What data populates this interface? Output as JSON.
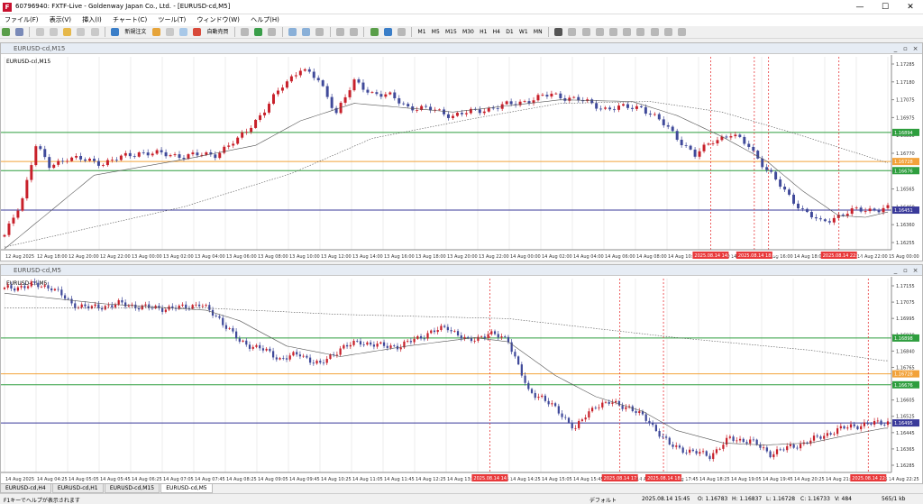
{
  "app": {
    "title": "60796940: FXTF-Live - Goldenway Japan Co., Ltd. - [EURUSD-cd,M5]",
    "icon_letter": "F"
  },
  "window_controls": [
    "—",
    "☐",
    "✕"
  ],
  "menu": [
    "ファイル(F)",
    "表示(V)",
    "挿入(I)",
    "チャート(C)",
    "ツール(T)",
    "ウィンドウ(W)",
    "ヘルプ(H)"
  ],
  "toolbar": {
    "new_order": "新規注文",
    "auto_trade": "自動売買",
    "timeframes": [
      "M1",
      "M5",
      "M15",
      "M30",
      "H1",
      "H4",
      "D1",
      "W1",
      "MN"
    ]
  },
  "colors": {
    "bull": "#c8202a",
    "bear": "#404a9a",
    "grid": "#ececec",
    "hline_green": "#2e9e3e",
    "hline_orange": "#f2a23a",
    "hline_blue": "#3a3a9a",
    "vline_red": "#e8383a",
    "ma_solid": "#555555",
    "ma_dotted": "#555555"
  },
  "chart_top": {
    "title": "EURUSD-cd,M15",
    "symbol_label": "EURUSD-cd,M15",
    "ylim": [
      16225,
      17325
    ],
    "price_ticks": [
      "1.17285",
      "1.17180",
      "1.17075",
      "1.16975",
      "1.16880",
      "1.16770",
      "1.16665",
      "1.16565",
      "1.16460",
      "1.16360",
      "1.16255"
    ],
    "hlines": [
      {
        "price": 16894,
        "label": "1.16894",
        "color": "green"
      },
      {
        "price": 16728,
        "label": "1.16728",
        "color": "orange"
      },
      {
        "price": 16676,
        "label": "1.16676",
        "color": "green"
      },
      {
        "price": 16451,
        "label": "1.16451",
        "color": "blue"
      }
    ],
    "vlines_x": [
      0.797,
      0.846,
      0.862,
      0.941
    ],
    "time_labels": [
      "12 Aug 2025",
      "12 Aug 18:00",
      "12 Aug 20:00",
      "12 Aug 22:00",
      "13 Aug 00:00",
      "13 Aug 02:00",
      "13 Aug 04:00",
      "13 Aug 06:00",
      "13 Aug 08:00",
      "13 Aug 10:00",
      "13 Aug 12:00",
      "13 Aug 14:00",
      "13 Aug 16:00",
      "13 Aug 18:00",
      "13 Aug 20:00",
      "13 Aug 22:00",
      "14 Aug 00:00",
      "14 Aug 02:00",
      "14 Aug 04:00",
      "14 Aug 06:00",
      "14 Aug 08:00",
      "14 Aug 10:00",
      "14 Aug 12:00",
      "14 Aug 14:00",
      "14 Aug 16:00",
      "14 Aug 18:00",
      "14 Aug 20:00",
      "14 Aug 22:00",
      "15 Aug 00:00"
    ],
    "red_time_labels": [
      {
        "x": 0.797,
        "label": "2025.08.14 14:15"
      },
      {
        "x": 0.846,
        "label": "2025.08.14 18:00"
      },
      {
        "x": 0.941,
        "label": "2025.08.14 22:30"
      }
    ],
    "close_keys": [
      [
        0,
        16300
      ],
      [
        4,
        16520
      ],
      [
        7,
        16820
      ],
      [
        10,
        16700
      ],
      [
        14,
        16750
      ],
      [
        22,
        16720
      ],
      [
        30,
        16780
      ],
      [
        40,
        16760
      ],
      [
        47,
        16770
      ],
      [
        52,
        16850
      ],
      [
        58,
        17020
      ],
      [
        62,
        17160
      ],
      [
        66,
        17260
      ],
      [
        70,
        17190
      ],
      [
        74,
        17010
      ],
      [
        78,
        17180
      ],
      [
        82,
        17120
      ],
      [
        86,
        17100
      ],
      [
        90,
        17040
      ],
      [
        96,
        17020
      ],
      [
        100,
        16990
      ],
      [
        106,
        17020
      ],
      [
        114,
        17060
      ],
      [
        122,
        17110
      ],
      [
        128,
        17080
      ],
      [
        134,
        17030
      ],
      [
        142,
        17040
      ],
      [
        148,
        16920
      ],
      [
        154,
        16760
      ],
      [
        158,
        16850
      ],
      [
        162,
        16880
      ],
      [
        166,
        16820
      ],
      [
        170,
        16680
      ],
      [
        174,
        16560
      ],
      [
        178,
        16450
      ],
      [
        182,
        16380
      ],
      [
        186,
        16420
      ],
      [
        190,
        16450
      ],
      [
        197,
        16460
      ]
    ],
    "ma_keys": [
      [
        0,
        16230
      ],
      [
        20,
        16650
      ],
      [
        40,
        16740
      ],
      [
        56,
        16820
      ],
      [
        66,
        16960
      ],
      [
        78,
        17060
      ],
      [
        100,
        17010
      ],
      [
        124,
        17080
      ],
      [
        140,
        17070
      ],
      [
        150,
        16990
      ],
      [
        160,
        16870
      ],
      [
        170,
        16730
      ],
      [
        178,
        16560
      ],
      [
        186,
        16420
      ],
      [
        192,
        16410
      ],
      [
        197,
        16440
      ]
    ],
    "ma2_keys": [
      [
        0,
        16240
      ],
      [
        40,
        16470
      ],
      [
        64,
        16660
      ],
      [
        82,
        16860
      ],
      [
        104,
        16970
      ],
      [
        124,
        17060
      ],
      [
        144,
        17070
      ],
      [
        160,
        17010
      ],
      [
        176,
        16890
      ],
      [
        197,
        16720
      ]
    ],
    "n_candles": 198
  },
  "chart_bottom": {
    "title": "EURUSD-cd,M5",
    "symbol_label": "EURUSD-cd,M5",
    "ylim": [
      16260,
      17180
    ],
    "price_ticks": [
      "1.17155",
      "1.17075",
      "1.16995",
      "1.16920",
      "1.16840",
      "1.16765",
      "1.16685",
      "1.16605",
      "1.16525",
      "1.16445",
      "1.16365",
      "1.16285"
    ],
    "hlines": [
      {
        "price": 16898,
        "label": "1.16898",
        "color": "green"
      },
      {
        "price": 16728,
        "label": "1.16728",
        "color": "orange"
      },
      {
        "price": 16676,
        "label": "1.16676",
        "color": "green"
      },
      {
        "price": 16495,
        "label": "1.16495",
        "color": "blue"
      }
    ],
    "vlines_x": [
      0.549,
      0.695,
      0.744,
      0.974
    ],
    "time_labels": [
      "14 Aug 2025",
      "14 Aug 04:25",
      "14 Aug 05:05",
      "14 Aug 05:45",
      "14 Aug 06:25",
      "14 Aug 07:05",
      "14 Aug 07:45",
      "14 Aug 08:25",
      "14 Aug 09:05",
      "14 Aug 09:45",
      "14 Aug 10:25",
      "14 Aug 11:05",
      "14 Aug 11:45",
      "14 Aug 12:25",
      "14 Aug 13:05",
      "14 Aug 13:45",
      "14 Aug 14:25",
      "14 Aug 15:05",
      "14 Aug 15:45",
      "14 Aug 16:25",
      "14 Aug 17:05",
      "14 Aug 17:45",
      "14 Aug 18:25",
      "14 Aug 19:05",
      "14 Aug 19:45",
      "14 Aug 20:25",
      "14 Aug 21:05",
      "14 Aug 21:45",
      "14 Aug 22:25"
    ],
    "red_time_labels": [
      {
        "x": 0.549,
        "label": "2025.08.14 14:15"
      },
      {
        "x": 0.695,
        "label": "2025.08.14 17:05"
      },
      {
        "x": 0.744,
        "label": "2025.08.14 18:00"
      },
      {
        "x": 0.974,
        "label": "2025.08.14 22:30"
      }
    ],
    "close_keys": [
      [
        0,
        17130
      ],
      [
        8,
        17150
      ],
      [
        14,
        17140
      ],
      [
        20,
        17060
      ],
      [
        26,
        17040
      ],
      [
        34,
        17060
      ],
      [
        44,
        17040
      ],
      [
        52,
        17040
      ],
      [
        58,
        17060
      ],
      [
        64,
        16990
      ],
      [
        70,
        16880
      ],
      [
        76,
        16850
      ],
      [
        82,
        16800
      ],
      [
        88,
        16820
      ],
      [
        94,
        16770
      ],
      [
        100,
        16850
      ],
      [
        106,
        16880
      ],
      [
        112,
        16860
      ],
      [
        118,
        16860
      ],
      [
        126,
        16920
      ],
      [
        132,
        16950
      ],
      [
        138,
        16880
      ],
      [
        144,
        16920
      ],
      [
        150,
        16890
      ],
      [
        156,
        16640
      ],
      [
        160,
        16620
      ],
      [
        164,
        16560
      ],
      [
        170,
        16470
      ],
      [
        176,
        16580
      ],
      [
        180,
        16590
      ],
      [
        186,
        16570
      ],
      [
        192,
        16500
      ],
      [
        198,
        16390
      ],
      [
        204,
        16360
      ],
      [
        210,
        16340
      ],
      [
        216,
        16420
      ],
      [
        222,
        16410
      ],
      [
        228,
        16350
      ],
      [
        234,
        16380
      ],
      [
        240,
        16410
      ],
      [
        246,
        16450
      ],
      [
        252,
        16480
      ],
      [
        258,
        16490
      ],
      [
        262,
        16500
      ]
    ],
    "ma_keys": [
      [
        0,
        17110
      ],
      [
        30,
        17060
      ],
      [
        60,
        17030
      ],
      [
        70,
        16980
      ],
      [
        84,
        16860
      ],
      [
        100,
        16810
      ],
      [
        120,
        16860
      ],
      [
        140,
        16900
      ],
      [
        150,
        16880
      ],
      [
        164,
        16720
      ],
      [
        176,
        16620
      ],
      [
        190,
        16550
      ],
      [
        200,
        16460
      ],
      [
        214,
        16400
      ],
      [
        226,
        16390
      ],
      [
        240,
        16400
      ],
      [
        252,
        16440
      ],
      [
        262,
        16470
      ]
    ],
    "ma2_keys": [
      [
        0,
        17040
      ],
      [
        60,
        17040
      ],
      [
        100,
        17010
      ],
      [
        150,
        16990
      ],
      [
        200,
        16900
      ],
      [
        240,
        16840
      ],
      [
        262,
        16790
      ]
    ],
    "n_candles": 264
  },
  "tabs": [
    "EURUSD-cd,H4",
    "EURUSD-cd,H1",
    "EURUSD-cd,M15",
    "EURUSD-cd,M5"
  ],
  "status": {
    "help": "F1キーでヘルプが表示されます",
    "profile": "デフォルト",
    "datetime": "2025.08.14 15:45",
    "open": "O: 1.16783",
    "high": "H: 1.16837",
    "low": "L: 1.16728",
    "close": "C: 1.16733",
    "volume": "V: 484",
    "traffic": "565/1 kb"
  }
}
